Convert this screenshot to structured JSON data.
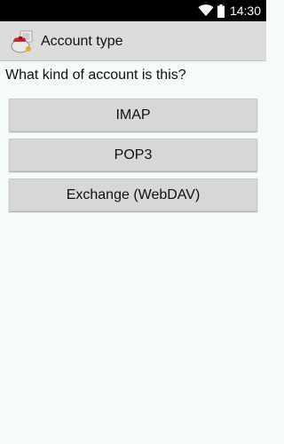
{
  "status_bar": {
    "time": "14:30",
    "icons": [
      "wifi-icon",
      "battery-icon"
    ]
  },
  "action_bar": {
    "icon": "app-icon",
    "title": "Account type"
  },
  "main": {
    "question": "What kind of account is this?",
    "buttons": [
      {
        "label": "IMAP"
      },
      {
        "label": "POP3"
      },
      {
        "label": "Exchange (WebDAV)"
      }
    ]
  }
}
